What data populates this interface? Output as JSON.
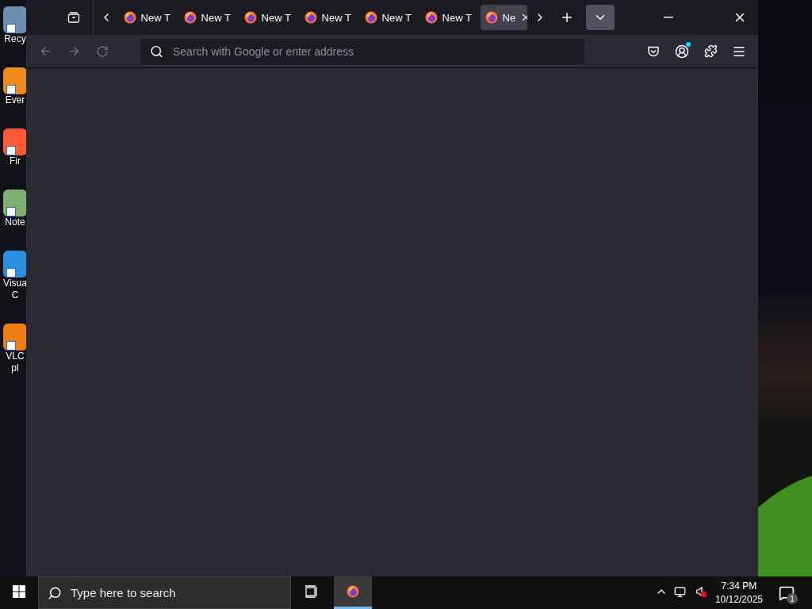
{
  "desktop_icons": [
    {
      "kind": "recycle",
      "lines": [
        "Recy"
      ]
    },
    {
      "kind": "app",
      "lines": [
        "Ever"
      ]
    },
    {
      "kind": "fire",
      "lines": [
        "Fir"
      ]
    },
    {
      "kind": "notepad",
      "lines": [
        "Note"
      ]
    },
    {
      "kind": "code",
      "lines": [
        "Visua",
        "C"
      ]
    },
    {
      "kind": "cone",
      "lines": [
        "VLC",
        "pl"
      ]
    }
  ],
  "browser": {
    "tabs": [
      {
        "label": "New T",
        "selected": false
      },
      {
        "label": "New T",
        "selected": false
      },
      {
        "label": "New T",
        "selected": false
      },
      {
        "label": "New T",
        "selected": false
      },
      {
        "label": "New T",
        "selected": false
      },
      {
        "label": "New T",
        "selected": false
      },
      {
        "label": "Ne",
        "selected": true
      }
    ],
    "address_bar": {
      "placeholder": "Search with Google or enter address"
    },
    "account_notification": true
  },
  "taskbar": {
    "search": {
      "placeholder": "Type here to search"
    },
    "firefox_active": true,
    "time": "7:34 PM",
    "date": "10/12/2025",
    "notification_count": "1"
  }
}
